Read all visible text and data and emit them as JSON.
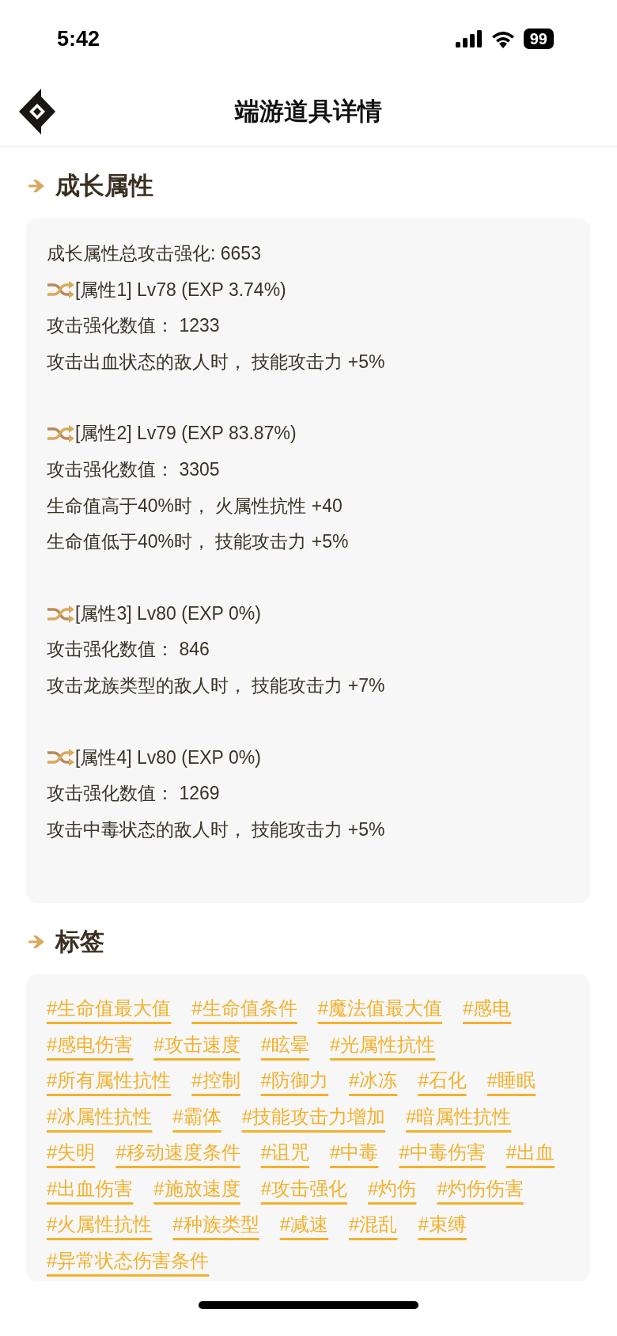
{
  "status_bar": {
    "time": "5:42",
    "battery": "99"
  },
  "header": {
    "title": "端游道具详情"
  },
  "growth": {
    "heading": "成长属性",
    "total": "成长属性总攻击强化: 6653",
    "attributes": [
      {
        "title": "[属性1] Lv78 (EXP 3.74%)",
        "lines": [
          "攻击强化数值： 1233",
          "攻击出血状态的敌人时， 技能攻击力 +5%"
        ]
      },
      {
        "title": "[属性2] Lv79 (EXP 83.87%)",
        "lines": [
          "攻击强化数值： 3305",
          "生命值高于40%时， 火属性抗性 +40",
          "生命值低于40%时， 技能攻击力 +5%"
        ]
      },
      {
        "title": "[属性3] Lv80 (EXP 0%)",
        "lines": [
          "攻击强化数值： 846",
          "攻击龙族类型的敌人时， 技能攻击力 +7%"
        ]
      },
      {
        "title": "[属性4] Lv80 (EXP 0%)",
        "lines": [
          "攻击强化数值： 1269",
          "攻击中毒状态的敌人时， 技能攻击力 +5%"
        ]
      }
    ]
  },
  "tags_section": {
    "heading": "标签",
    "tags": [
      "#生命值最大值",
      "#生命值条件",
      "#魔法值最大值",
      "#感电",
      "#感电伤害",
      "#攻击速度",
      "#眩晕",
      "#光属性抗性",
      "#所有属性抗性",
      "#控制",
      "#防御力",
      "#冰冻",
      "#石化",
      "#睡眠",
      "#冰属性抗性",
      "#霸体",
      "#技能攻击力增加",
      "#暗属性抗性",
      "#失明",
      "#移动速度条件",
      "#诅咒",
      "#中毒",
      "#中毒伤害",
      "#出血",
      "#出血伤害",
      "#施放速度",
      "#攻击强化",
      "#灼伤",
      "#灼伤伤害",
      "#火属性抗性",
      "#种族类型",
      "#减速",
      "#混乱",
      "#束缚",
      "#异常状态伤害条件"
    ]
  }
}
